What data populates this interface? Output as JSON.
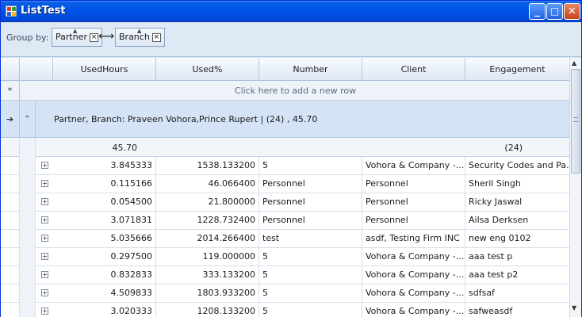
{
  "window": {
    "title": "ListTest",
    "buttons": {
      "minimize": "_",
      "maximize": "□",
      "close": "✕"
    }
  },
  "groupbar": {
    "label": "Group by:",
    "chips": [
      {
        "label": "Partner"
      },
      {
        "label": "Branch"
      }
    ],
    "remove_glyph": "×"
  },
  "grid": {
    "columns": [
      "UsedHours",
      "Used%",
      "Number",
      "Client",
      "Engagement"
    ],
    "add_row_text": "Click here to add a new row",
    "new_row_glyph": "*",
    "group": {
      "text": "Partner, Branch: Praveen Vohora,Prince Rupert | (24) , 45.70",
      "current_glyph": "➔",
      "collapse_glyph": "⌃"
    },
    "summary": {
      "used_hours": "45.70",
      "count": "(24)"
    },
    "expand_glyph": "+",
    "rows": [
      {
        "used_hours": "3.845333",
        "used_pct": "1538.133200",
        "number": "5",
        "client": "Vohora & Company -...",
        "engagement": "Security Codes and Pa..."
      },
      {
        "used_hours": "0.115166",
        "used_pct": "46.066400",
        "number": "Personnel",
        "client": "Personnel",
        "engagement": "Sheril Singh"
      },
      {
        "used_hours": "0.054500",
        "used_pct": "21.800000",
        "number": "Personnel",
        "client": "Personnel",
        "engagement": "Ricky Jaswal"
      },
      {
        "used_hours": "3.071831",
        "used_pct": "1228.732400",
        "number": "Personnel",
        "client": "Personnel",
        "engagement": "Ailsa Derksen"
      },
      {
        "used_hours": "5.035666",
        "used_pct": "2014.266400",
        "number": "test",
        "client": "asdf, Testing Firm INC",
        "engagement": "new eng 0102"
      },
      {
        "used_hours": "0.297500",
        "used_pct": "119.000000",
        "number": "5",
        "client": "Vohora & Company -...",
        "engagement": "aaa test p"
      },
      {
        "used_hours": "0.832833",
        "used_pct": "333.133200",
        "number": "5",
        "client": "Vohora & Company -...",
        "engagement": "aaa test p2"
      },
      {
        "used_hours": "4.509833",
        "used_pct": "1803.933200",
        "number": "5",
        "client": "Vohora & Company -...",
        "engagement": "sdfsaf"
      },
      {
        "used_hours": "3.020333",
        "used_pct": "1208.133200",
        "number": "5",
        "client": "Vohora & Company -...",
        "engagement": "safweasdf"
      }
    ]
  },
  "scrollbar": {
    "up_arrow": "▲",
    "down_arrow": "▼"
  }
}
